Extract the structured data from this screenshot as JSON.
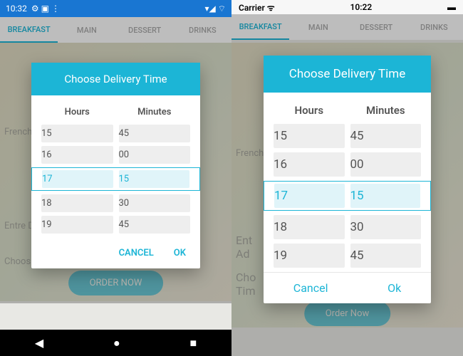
{
  "android": {
    "statusbar": {
      "time": "10:32",
      "icons_left": "⚙ ▣ ⋮",
      "icons_right": "▾◢ ⌔"
    },
    "tabs": [
      "BREAKFAST",
      "MAIN",
      "DESSERT",
      "DRINKS"
    ],
    "active_tab": 0,
    "order_btn": "ORDER NOW",
    "bg_labels": {
      "french": "French B",
      "entre": "Entre D",
      "choose": "Choos"
    },
    "dialog": {
      "title": "Choose Delivery Time",
      "hours_label": "Hours",
      "minutes_label": "Minutes",
      "hours": [
        "15",
        "16",
        "17",
        "18",
        "19"
      ],
      "minutes": [
        "45",
        "00",
        "15",
        "30",
        "45"
      ],
      "selected_index": 2,
      "cancel": "CANCEL",
      "ok": "OK"
    }
  },
  "ios": {
    "statusbar": {
      "carrier": "Carrier ᯤ",
      "time": "10:22",
      "battery": "▬"
    },
    "tabs": [
      "BREAKFAST",
      "MAIN",
      "DESSERT",
      "DRINKS"
    ],
    "active_tab": 0,
    "order_btn": "Order Now",
    "bg_labels": {
      "french": "French",
      "entre": "Ent\nAd",
      "choose": "Cho\nTim"
    },
    "dialog": {
      "title": "Choose Delivery Time",
      "hours_label": "Hours",
      "minutes_label": "Minutes",
      "hours": [
        "15",
        "16",
        "17",
        "18",
        "19"
      ],
      "minutes": [
        "45",
        "00",
        "15",
        "30",
        "45"
      ],
      "selected_index": 2,
      "cancel": "Cancel",
      "ok": "Ok"
    }
  }
}
